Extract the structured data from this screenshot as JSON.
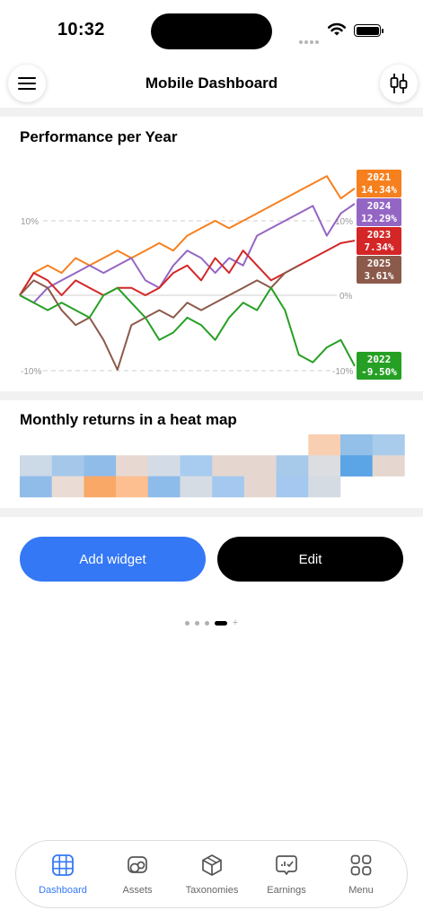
{
  "status": {
    "time": "10:32"
  },
  "header": {
    "title": "Mobile Dashboard"
  },
  "performance": {
    "title": "Performance per Year",
    "axis_labels": {
      "top": "10%",
      "top_right": "10%",
      "mid": "0%",
      "bottom": "-10%",
      "bottom_right": "-10%"
    },
    "legend": [
      {
        "year": "2021",
        "value": "14.34%",
        "color": "#f7801e"
      },
      {
        "year": "2024",
        "value": "12.29%",
        "color": "#9466c4"
      },
      {
        "year": "2023",
        "value": "7.34%",
        "color": "#d42626"
      },
      {
        "year": "2025",
        "value": "3.61%",
        "color": "#8c5a4a"
      },
      {
        "year": "2022",
        "value": "-9.50%",
        "color": "#26a024"
      }
    ]
  },
  "chart_data": {
    "type": "line",
    "ylim": [
      -10.5,
      16
    ],
    "y_ticks": [
      10,
      0,
      -10
    ],
    "grid": true,
    "legend_placement": "right",
    "x": [
      0,
      1,
      2,
      3,
      4,
      5,
      6,
      7,
      8,
      9,
      10,
      11,
      12,
      13,
      14,
      15,
      16,
      17,
      18,
      19,
      20,
      21,
      22,
      23,
      24
    ],
    "series": [
      {
        "name": "2021",
        "color": "#f7801e",
        "values": [
          0,
          3,
          4,
          3,
          5,
          4,
          5,
          6,
          5,
          6,
          7,
          6,
          8,
          9,
          10,
          9,
          10,
          11,
          12,
          13,
          14,
          15,
          16,
          13,
          14.34
        ]
      },
      {
        "name": "2024",
        "color": "#9466c4",
        "values": [
          0,
          -1,
          1,
          2,
          3,
          4,
          3,
          4,
          5,
          2,
          1,
          4,
          6,
          5,
          3,
          5,
          4,
          8,
          9,
          10,
          11,
          12,
          8,
          11,
          12.29
        ]
      },
      {
        "name": "2023",
        "color": "#d42626",
        "values": [
          0,
          3,
          2,
          0,
          2,
          1,
          0,
          1,
          1,
          0,
          1,
          3,
          4,
          2,
          5,
          3,
          6,
          4,
          2,
          3,
          4,
          5,
          6,
          7,
          7.34
        ]
      },
      {
        "name": "2025",
        "color": "#8c5a4a",
        "values": [
          0,
          2,
          1,
          -2,
          -4,
          -3,
          -6,
          -10,
          -4,
          -3,
          -2,
          -3,
          -1,
          -2,
          -1,
          0,
          1,
          2,
          1,
          3,
          4
        ]
      },
      {
        "name": "2022",
        "color": "#26a024",
        "values": [
          0,
          -1,
          -2,
          -1,
          -2,
          -3,
          0,
          1,
          -1,
          -3,
          -6,
          -5,
          -3,
          -4,
          -6,
          -3,
          -1,
          -2,
          1,
          -2,
          -8,
          -9,
          -7,
          -6,
          -9.5
        ]
      }
    ]
  },
  "heatmap": {
    "title": "Monthly returns in a heat map",
    "rows": [
      [
        "",
        "",
        "",
        "",
        "",
        "",
        "",
        "",
        "",
        "#f8cfb1",
        "#93c0e8",
        "#a9cbec"
      ],
      [
        "#ccd9e6",
        "#a5c8ea",
        "#90bcea",
        "#e7d9d2",
        "#d3dce6",
        "#a8ccef",
        "#e5d7cf",
        "#e5d7cf",
        "#a7c9ea",
        "#dcdde0",
        "#5ba4e6",
        "#e5d7cf"
      ],
      [
        "#90bcea",
        "#eadcd4",
        "#f9a868",
        "#fdbf90",
        "#8ebcea",
        "#d6dce3",
        "#a4c8ef",
        "#e5d7cf",
        "#a4c8ef",
        "#d4dbe3",
        "",
        ""
      ]
    ]
  },
  "actions": {
    "add_label": "Add widget",
    "edit_label": "Edit"
  },
  "pager": {
    "plus": "+"
  },
  "tabs": [
    {
      "label": "Dashboard",
      "icon": "dashboard-grid-icon",
      "active": true
    },
    {
      "label": "Assets",
      "icon": "assets-coins-icon",
      "active": false
    },
    {
      "label": "Taxonomies",
      "icon": "taxonomies-cube-icon",
      "active": false
    },
    {
      "label": "Earnings",
      "icon": "earnings-chart-icon",
      "active": false
    },
    {
      "label": "Menu",
      "icon": "menu-grid-icon",
      "active": false
    }
  ]
}
